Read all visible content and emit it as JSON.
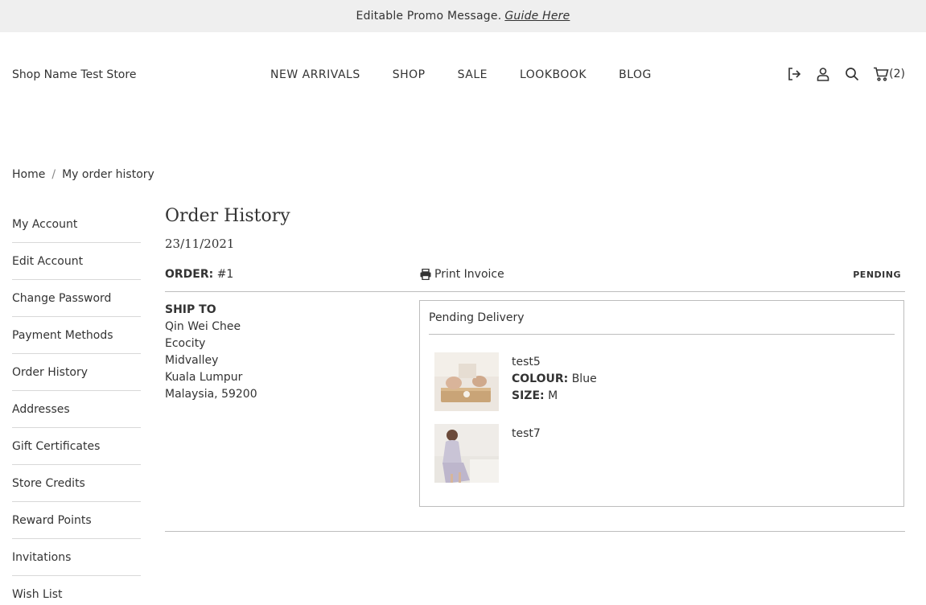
{
  "promo": {
    "message": "Editable Promo Message.",
    "link": "Guide Here"
  },
  "header": {
    "shop_name": "Shop Name Test Store",
    "nav": [
      "NEW ARRIVALS",
      "SHOP",
      "SALE",
      "LOOKBOOK",
      "BLOG"
    ],
    "cart_count": "(2)"
  },
  "breadcrumb": {
    "home": "Home",
    "separator": "/",
    "current": "My order history"
  },
  "sidebar": {
    "items": [
      {
        "label": "My Account"
      },
      {
        "label": "Edit Account"
      },
      {
        "label": "Change Password"
      },
      {
        "label": "Payment Methods"
      },
      {
        "label": "Order History"
      },
      {
        "label": "Addresses"
      },
      {
        "label": "Gift Certificates"
      },
      {
        "label": "Store Credits"
      },
      {
        "label": "Reward Points"
      },
      {
        "label": "Invitations"
      },
      {
        "label": "Wish List"
      }
    ]
  },
  "order": {
    "title": "Order History",
    "date": "23/11/2021",
    "order_label": "ORDER:",
    "order_number": "#1",
    "print_label": "Print Invoice",
    "status": "PENDING",
    "ship_to": {
      "heading": "SHIP TO",
      "lines": [
        "Qin Wei Chee",
        "Ecocity",
        "Midvalley",
        "Kuala Lumpur",
        "Malaysia, 59200"
      ]
    },
    "delivery": {
      "heading": "Pending Delivery",
      "products": [
        {
          "name": "test5",
          "colour_label": "COLOUR:",
          "colour": "Blue",
          "size_label": "SIZE:",
          "size": "M"
        },
        {
          "name": "test7"
        }
      ]
    }
  },
  "colors": {
    "promo_bg": "#efefef",
    "text": "#333333",
    "divider": "#bdbdbd"
  }
}
